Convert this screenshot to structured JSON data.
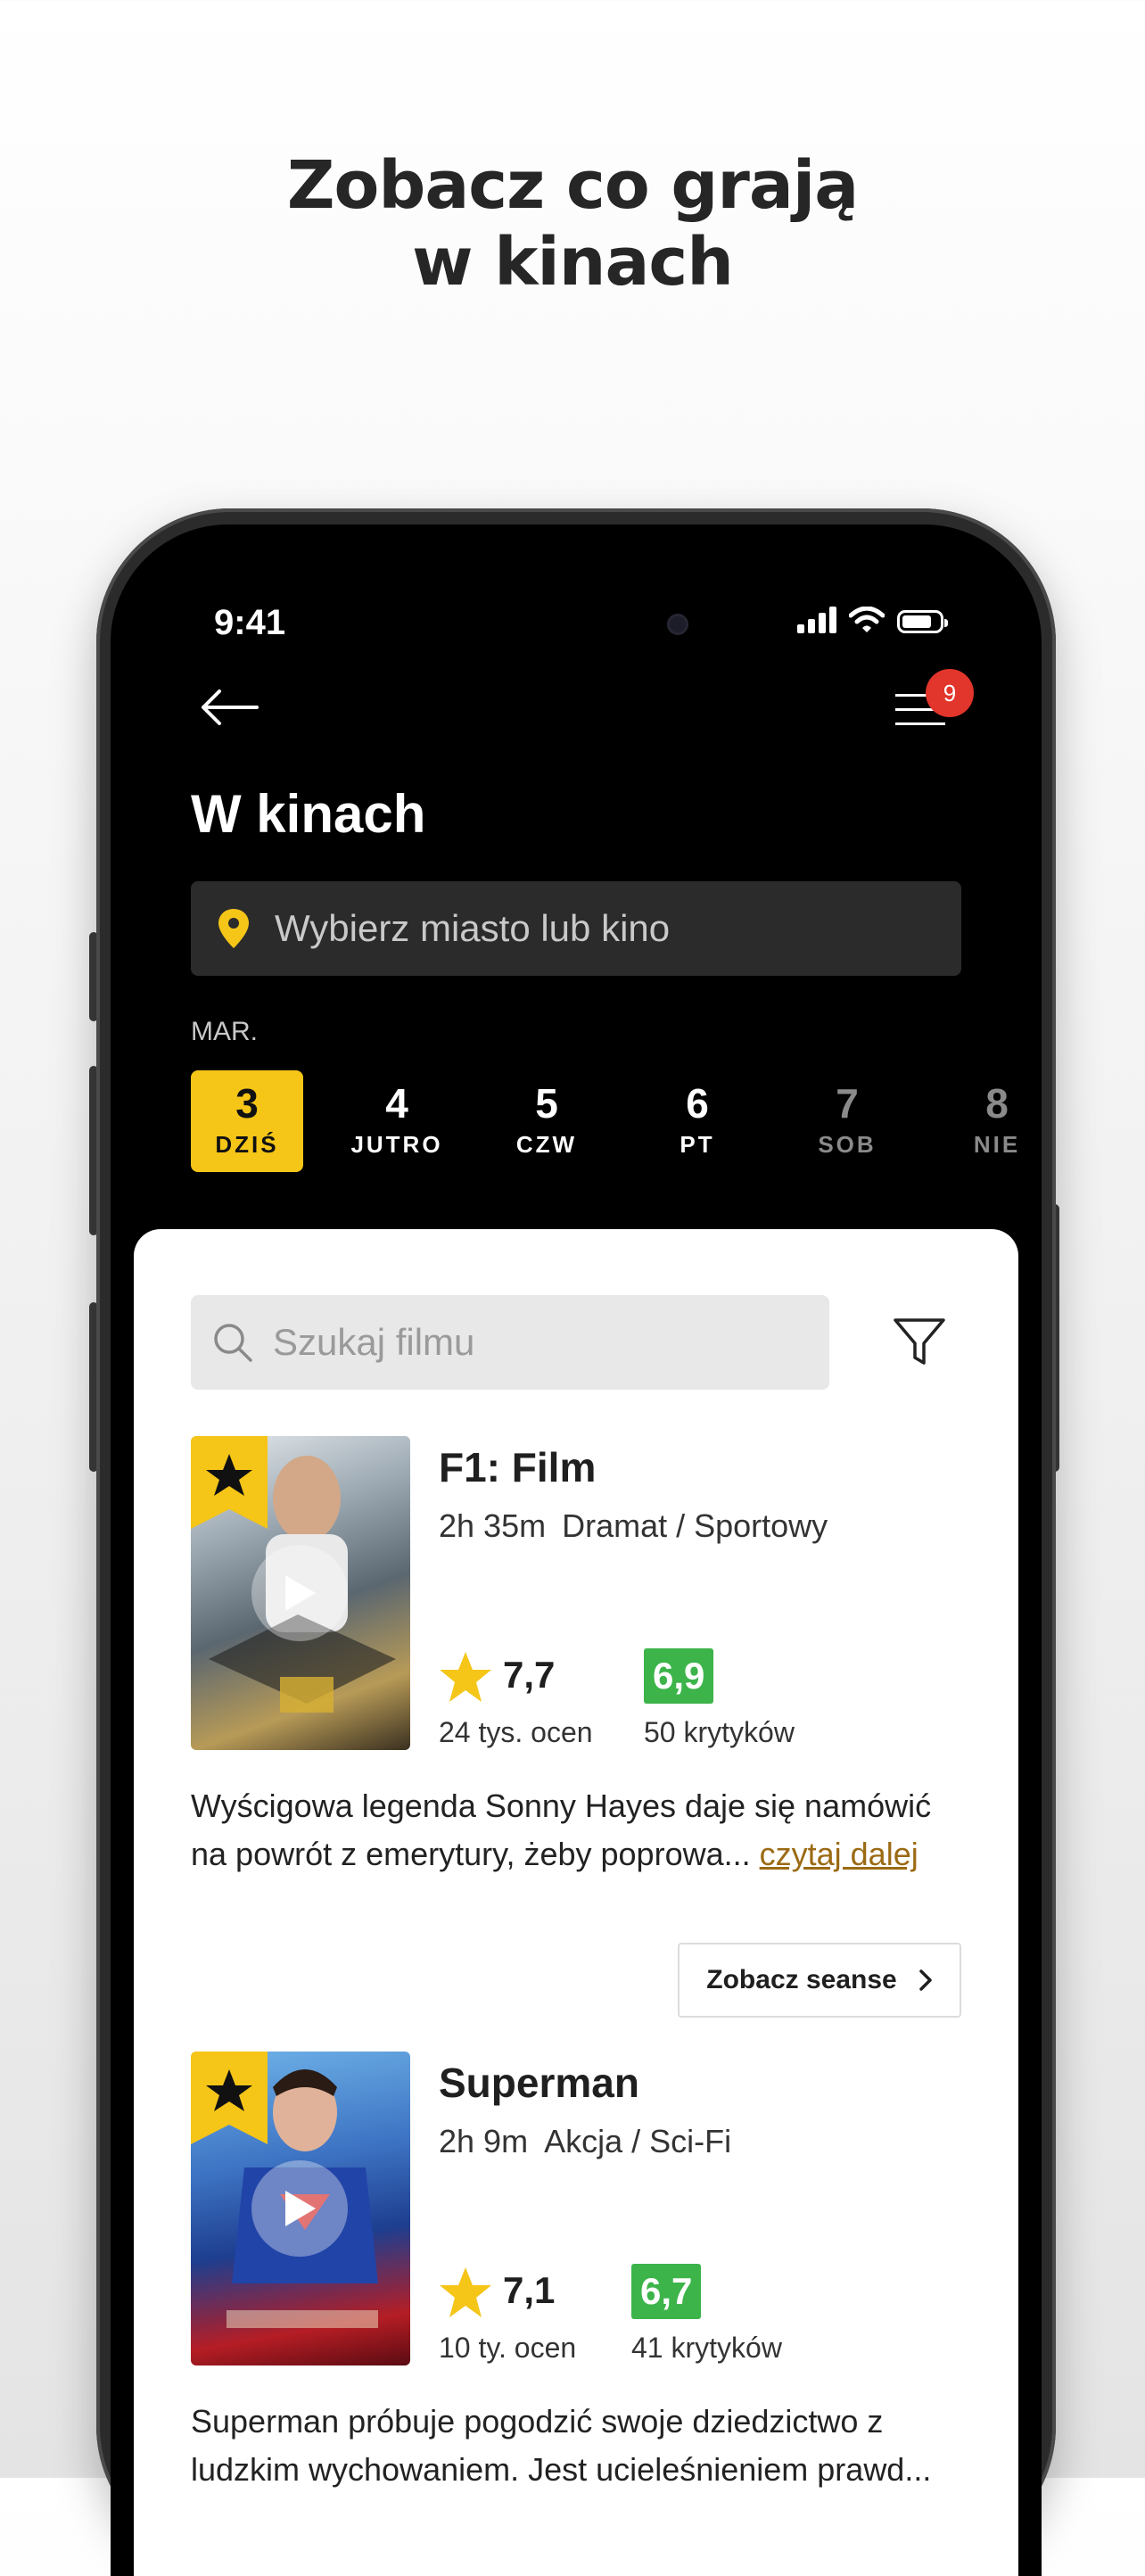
{
  "promo": {
    "line1": "Zobacz co grają",
    "line2": "w kinach"
  },
  "status_bar": {
    "time": "9:41"
  },
  "header": {
    "title": "W kinach",
    "notification_count": "9"
  },
  "city_select": {
    "placeholder": "Wybierz miasto lub kino"
  },
  "dates": {
    "month": "MAR.",
    "items": [
      {
        "num": "3",
        "day": "DZIŚ",
        "state": "selected"
      },
      {
        "num": "4",
        "day": "JUTRO",
        "state": "normal"
      },
      {
        "num": "5",
        "day": "CZW",
        "state": "normal"
      },
      {
        "num": "6",
        "day": "PT",
        "state": "normal"
      },
      {
        "num": "7",
        "day": "SOB",
        "state": "weekend"
      },
      {
        "num": "8",
        "day": "NIE",
        "state": "weekend"
      }
    ]
  },
  "search": {
    "placeholder": "Szukaj filmu"
  },
  "colors": {
    "accent": "#f5c518",
    "critic": "#3cb44a",
    "badge": "#e2352b",
    "link": "#9b6a13"
  },
  "movies": [
    {
      "title": "F1: Film",
      "duration": "2h 35m",
      "genres": "Dramat / Sportowy",
      "rating": "7,7",
      "rating_count": "24 tys. ocen",
      "critic_score": "6,9",
      "critic_count": "50 krytyków",
      "description": "Wyścigowa legenda Sonny Hayes daje się namówić na powrót z emerytury, żeby poprowa...",
      "read_more": "czytaj dalej",
      "sessions_label": "Zobacz seanse"
    },
    {
      "title": "Superman",
      "duration": "2h 9m",
      "genres": "Akcja / Sci-Fi",
      "rating": "7,1",
      "rating_count": "10 ty. ocen",
      "critic_score": "6,7",
      "critic_count": "41 krytyków",
      "description": "Superman próbuje pogodzić swoje dziedzictwo z ludzkim wychowaniem. Jest ucieleśnieniem prawd..."
    }
  ]
}
